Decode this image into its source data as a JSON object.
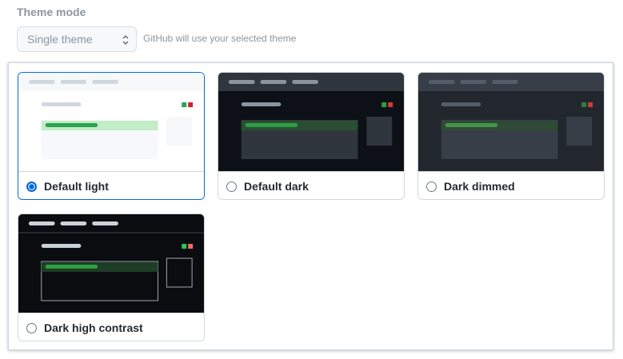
{
  "header": {
    "title": "Theme mode",
    "select_value": "Single theme",
    "hint": "GitHub will use your selected theme"
  },
  "themes": [
    {
      "label": "Default light",
      "selected": true,
      "colors": {
        "top": "#f6f8fa",
        "body": "#ffffff",
        "pill": "#d0d7de",
        "box": "#f6f8fa",
        "hl": "#c2edc7",
        "bar": "#2da44e",
        "side": "#f6f8fa",
        "red": "#cf222e",
        "green": "#2da44e"
      }
    },
    {
      "label": "Default dark",
      "selected": false,
      "colors": {
        "top": "#30363d",
        "body": "#0d1117",
        "pill": "#8b949e",
        "box": "#30363d",
        "hl": "#2b4d34",
        "bar": "#2ea043",
        "side": "#30363d",
        "red": "#da3633",
        "green": "#2ea043"
      }
    },
    {
      "label": "Dark dimmed",
      "selected": false,
      "colors": {
        "top": "#373e47",
        "body": "#22272e",
        "pill": "#545d68",
        "box": "#373e47",
        "hl": "#2f4a37",
        "bar": "#46954a",
        "side": "#373e47",
        "red": "#c93c37",
        "green": "#347d39"
      }
    },
    {
      "label": "Dark high contrast",
      "selected": false,
      "colors": {
        "top": "#0a0c10",
        "body": "#0a0c10",
        "pill": "#c9d1d9",
        "box": "#0a0c10",
        "hl": "#1e3d26",
        "bar": "#2ea043",
        "side": "#0a0c10",
        "red": "#ff6a69",
        "green": "#26cd4d",
        "outline": "#9ea7b3"
      }
    }
  ]
}
